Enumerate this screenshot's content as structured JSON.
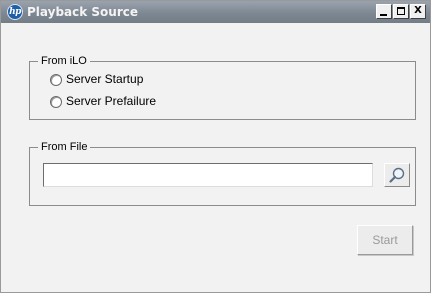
{
  "window": {
    "title": "Playback Source",
    "logo_text": "hp",
    "controls": {
      "minimize": "_",
      "maximize": "□",
      "close": "X"
    }
  },
  "from_ilo": {
    "legend": "From iLO",
    "options": [
      {
        "label": "Server Startup",
        "selected": false
      },
      {
        "label": "Server Prefailure",
        "selected": false
      }
    ]
  },
  "from_file": {
    "legend": "From File",
    "value": "",
    "browse_icon": "magnifier-icon"
  },
  "actions": {
    "start_label": "Start",
    "start_enabled": false
  },
  "colors": {
    "titlebar": "#808a95",
    "title_text": "#f4f4f4",
    "logo": "#1f5fa8",
    "background": "#f2f2f2",
    "disabled_text": "#9a9a9a"
  }
}
